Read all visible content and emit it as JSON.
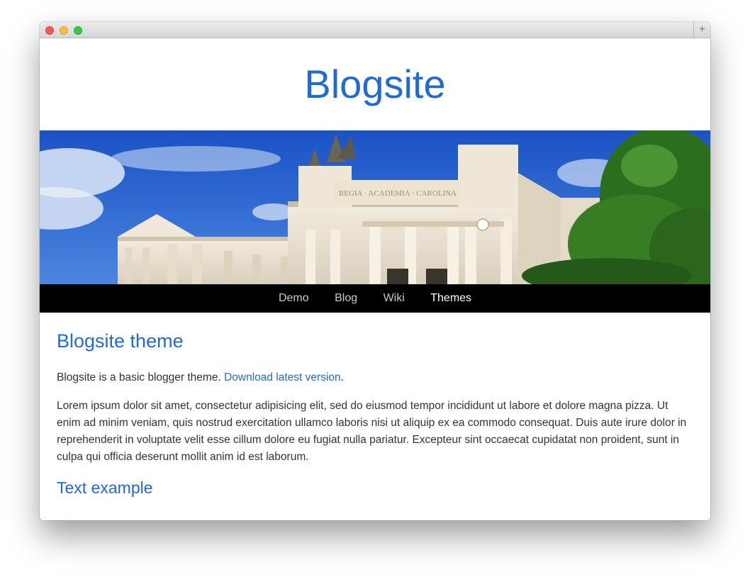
{
  "window": {
    "traffic_lights": [
      "close",
      "minimize",
      "maximize"
    ],
    "new_tab_icon": "plus-icon",
    "new_tab_label": "+"
  },
  "site": {
    "title": "Blogsite"
  },
  "hero": {
    "image": "university-building-photo"
  },
  "nav": {
    "items": [
      {
        "label": "Demo",
        "active": false
      },
      {
        "label": "Blog",
        "active": false
      },
      {
        "label": "Wiki",
        "active": false
      },
      {
        "label": "Themes",
        "active": true
      }
    ]
  },
  "content": {
    "heading": "Blogsite theme",
    "intro_text": "Blogsite is a basic blogger theme. ",
    "intro_link": "Download latest version",
    "intro_end": ".",
    "paragraph": "Lorem ipsum dolor sit amet, consectetur adipisicing elit, sed do eiusmod tempor incididunt ut labore et dolore magna pizza. Ut enim ad minim veniam, quis nostrud exercitation ullamco laboris nisi ut aliquip ex ea commodo consequat. Duis aute irure dolor in reprehenderit in voluptate velit esse cillum dolore eu fugiat nulla pariatur. Excepteur sint occaecat cupidatat non proident, sunt in culpa qui officia deserunt mollit anim id est laborum.",
    "subheading": "Text example"
  },
  "colors": {
    "accent": "#1f6bd0",
    "nav_bg": "#000000",
    "text": "#333333"
  }
}
